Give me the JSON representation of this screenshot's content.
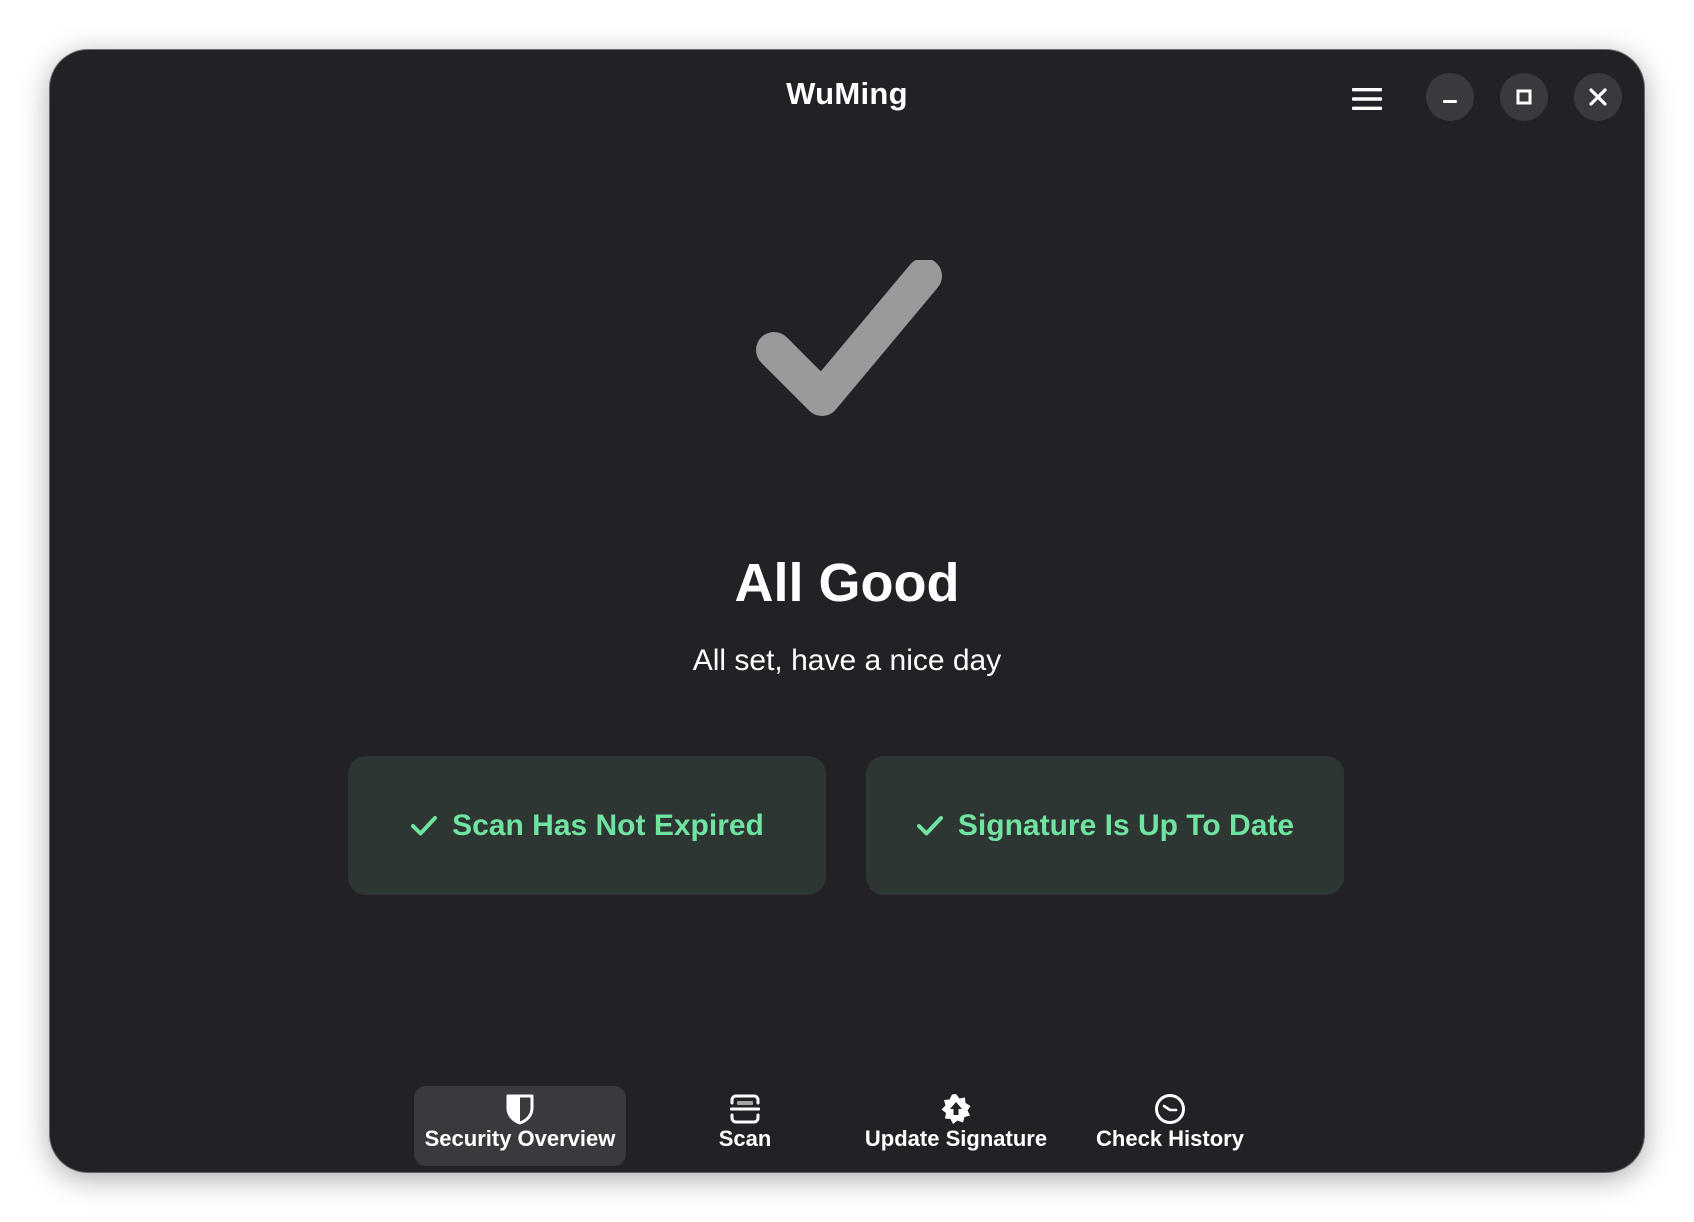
{
  "window": {
    "title": "WuMing",
    "controls": [
      "menu-icon",
      "minimize-icon",
      "maximize-icon",
      "close-icon"
    ]
  },
  "status": {
    "icon": "checkmark-icon",
    "icon_color": "#9a9a9c",
    "title": "All Good",
    "subtitle": "All set, have a nice day"
  },
  "cards": [
    {
      "label": "Scan Has Not Expired",
      "icon": "check-icon"
    },
    {
      "label": "Signature Is Up To Date",
      "icon": "check-icon"
    }
  ],
  "bottom_nav": {
    "items": [
      {
        "label": "Security Overview",
        "icon": "shield-icon",
        "active": true
      },
      {
        "label": "Scan",
        "icon": "scan-icon",
        "active": false
      },
      {
        "label": "Update Signature",
        "icon": "update-badge-icon",
        "active": false
      },
      {
        "label": "Check History",
        "icon": "clock-icon",
        "active": false
      }
    ]
  },
  "colors": {
    "window_bg": "#222226",
    "card_bg": "#2d3633",
    "accent_green": "#6fe3a0",
    "button_bg": "#3a3a3e"
  }
}
